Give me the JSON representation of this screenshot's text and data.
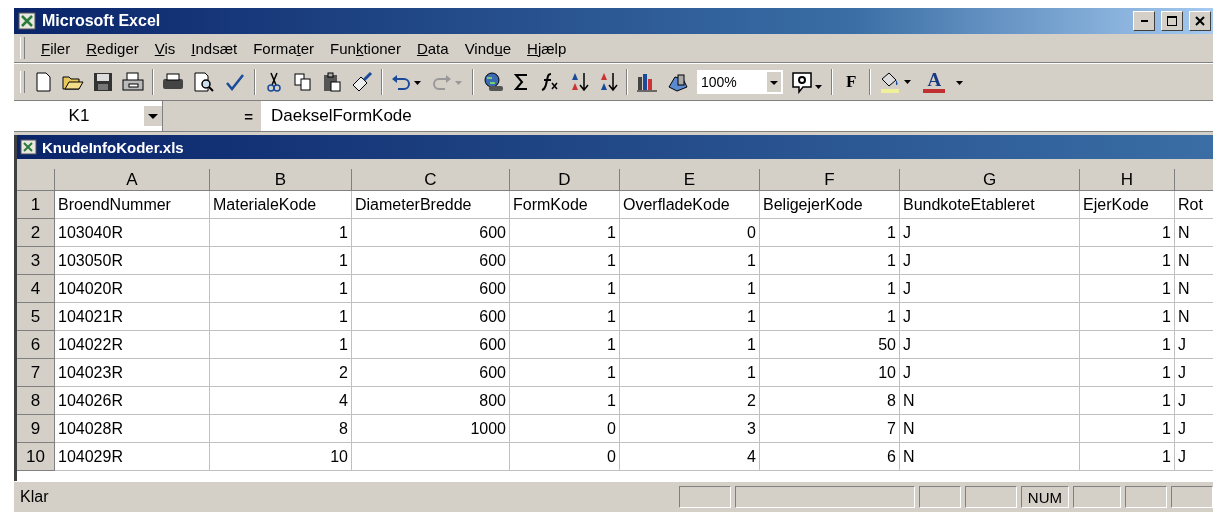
{
  "window": {
    "title": "Microsoft Excel"
  },
  "menu": [
    {
      "key": "F",
      "after": "iler"
    },
    {
      "key": "R",
      "after": "ediger"
    },
    {
      "key": "V",
      "after": "is"
    },
    {
      "key": "I",
      "after": "ndsæt"
    },
    {
      "before": "Forma",
      "key": "t",
      "after": "er"
    },
    {
      "before": "Fun",
      "key": "k",
      "after": "tioner"
    },
    {
      "key": "D",
      "after": "ata"
    },
    {
      "before": "Vind",
      "key": "u",
      "after": "e"
    },
    {
      "key": "H",
      "after": "jælp"
    }
  ],
  "toolbar": {
    "zoom": "100%",
    "bold": "F",
    "font_color": "A"
  },
  "formula_bar": {
    "name_box": "K1",
    "equals": "=",
    "content": "DaekselFormKode"
  },
  "workbook": {
    "title": "KnudeInfoKoder.xls"
  },
  "sheet": {
    "columns": [
      {
        "letter": "A",
        "numeric": false
      },
      {
        "letter": "B",
        "numeric": true
      },
      {
        "letter": "C",
        "numeric": true
      },
      {
        "letter": "D",
        "numeric": true
      },
      {
        "letter": "E",
        "numeric": true
      },
      {
        "letter": "F",
        "numeric": true
      },
      {
        "letter": "G",
        "numeric": false
      },
      {
        "letter": "H",
        "numeric": true
      },
      {
        "numeric": false
      }
    ],
    "rows": [
      {
        "number": "1",
        "kind": "labels",
        "cells": [
          "BroendNummer",
          "MaterialeKode",
          "DiameterBredde",
          "FormKode",
          "OverfladeKode",
          "BeligejerKode",
          "BundkoteEtableret",
          "EjerKode",
          "Rot"
        ]
      },
      {
        "number": "2",
        "kind": "values",
        "cells": [
          "103040R",
          "1",
          "600",
          "1",
          "0",
          "1",
          "J",
          "1",
          "N"
        ]
      },
      {
        "number": "3",
        "kind": "values",
        "cells": [
          "103050R",
          "1",
          "600",
          "1",
          "1",
          "1",
          "J",
          "1",
          "N"
        ]
      },
      {
        "number": "4",
        "kind": "values",
        "cells": [
          "104020R",
          "1",
          "600",
          "1",
          "1",
          "1",
          "J",
          "1",
          "N"
        ]
      },
      {
        "number": "5",
        "kind": "values",
        "cells": [
          "104021R",
          "1",
          "600",
          "1",
          "1",
          "1",
          "J",
          "1",
          "N"
        ]
      },
      {
        "number": "6",
        "kind": "values",
        "cells": [
          "104022R",
          "1",
          "600",
          "1",
          "1",
          "50",
          "J",
          "1",
          "J"
        ]
      },
      {
        "number": "7",
        "kind": "values",
        "cells": [
          "104023R",
          "2",
          "600",
          "1",
          "1",
          "10",
          "J",
          "1",
          "J"
        ]
      },
      {
        "number": "8",
        "kind": "values",
        "cells": [
          "104026R",
          "4",
          "800",
          "1",
          "2",
          "8",
          "N",
          "1",
          "J"
        ]
      },
      {
        "number": "9",
        "kind": "values",
        "cells": [
          "104028R",
          "8",
          "1000",
          "0",
          "3",
          "7",
          "N",
          "1",
          "J"
        ]
      },
      {
        "number": "10",
        "kind": "values",
        "cells": [
          "104029R",
          "10",
          "",
          "0",
          "4",
          "6",
          "N",
          "1",
          "J"
        ]
      }
    ]
  },
  "status_bar": {
    "text": "Klar",
    "indicator": "NUM"
  }
}
